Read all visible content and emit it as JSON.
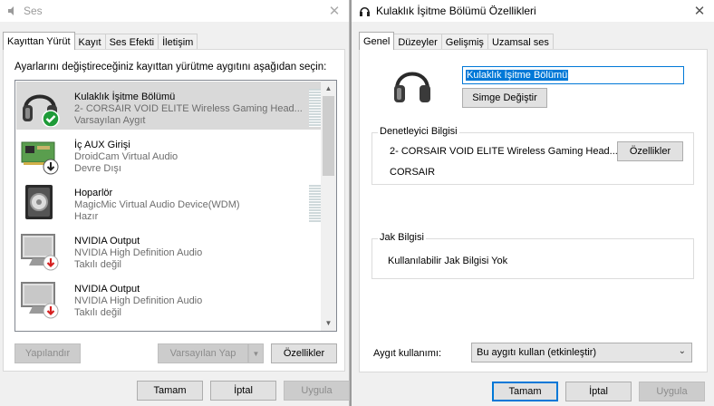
{
  "left_window": {
    "title": "Ses",
    "close_glyph": "✕",
    "tabs": [
      "Kayıttan Yürüt",
      "Kayıt",
      "Ses Efekti",
      "İletişim"
    ],
    "instruction": "Ayarlarını değiştireceğiniz kayıttan yürütme aygıtını aşağıdan seçin:",
    "devices": [
      {
        "name": "Kulaklık İşitme Bölümü",
        "desc": "2- CORSAIR VOID ELITE Wireless Gaming Head...",
        "status": "Varsayılan Aygıt",
        "icon": "headset-icon",
        "badge": "check-badge"
      },
      {
        "name": "İç AUX Girişi",
        "desc": "DroidCam Virtual Audio",
        "status": "Devre Dışı",
        "icon": "sound-card-icon",
        "badge": "down-arrow-badge"
      },
      {
        "name": "Hoparlör",
        "desc": "MagicMic Virtual Audio Device(WDM)",
        "status": "Hazır",
        "icon": "speaker-icon",
        "badge": ""
      },
      {
        "name": "NVIDIA Output",
        "desc": "NVIDIA High Definition Audio",
        "status": "Takılı değil",
        "icon": "monitor-icon",
        "badge": "red-down-arrow-badge"
      },
      {
        "name": "NVIDIA Output",
        "desc": "NVIDIA High Definition Audio",
        "status": "Takılı değil",
        "icon": "monitor-icon",
        "badge": "red-down-arrow-badge"
      }
    ],
    "buttons": {
      "configure": "Yapılandır",
      "set_default": "Varsayılan Yap",
      "properties": "Özellikler",
      "ok": "Tamam",
      "cancel": "İptal",
      "apply": "Uygula"
    }
  },
  "right_window": {
    "title": "Kulaklık İşitme Bölümü Özellikleri",
    "close_glyph": "✕",
    "tabs": [
      "Genel",
      "Düzeyler",
      "Gelişmiş",
      "Uzamsal ses"
    ],
    "device_name_value": "Kulaklık İşitme Bölümü",
    "change_icon_button": "Simge Değiştir",
    "controller": {
      "legend": "Denetleyici Bilgisi",
      "device": "2- CORSAIR VOID ELITE Wireless Gaming Head...",
      "manufacturer": "CORSAIR",
      "properties_button": "Özellikler"
    },
    "jack": {
      "legend": "Jak Bilgisi",
      "text": "Kullanılabilir Jak Bilgisi Yok"
    },
    "usage_label": "Aygıt kullanımı:",
    "usage_value": "Bu aygıtı kullan (etkinleştir)",
    "buttons": {
      "ok": "Tamam",
      "cancel": "İptal",
      "apply": "Uygula"
    }
  },
  "colors": {
    "accent": "#0078d7",
    "selection": "#d9d9d9",
    "check_green": "#1e9b38",
    "arrow_red": "#d62020"
  }
}
